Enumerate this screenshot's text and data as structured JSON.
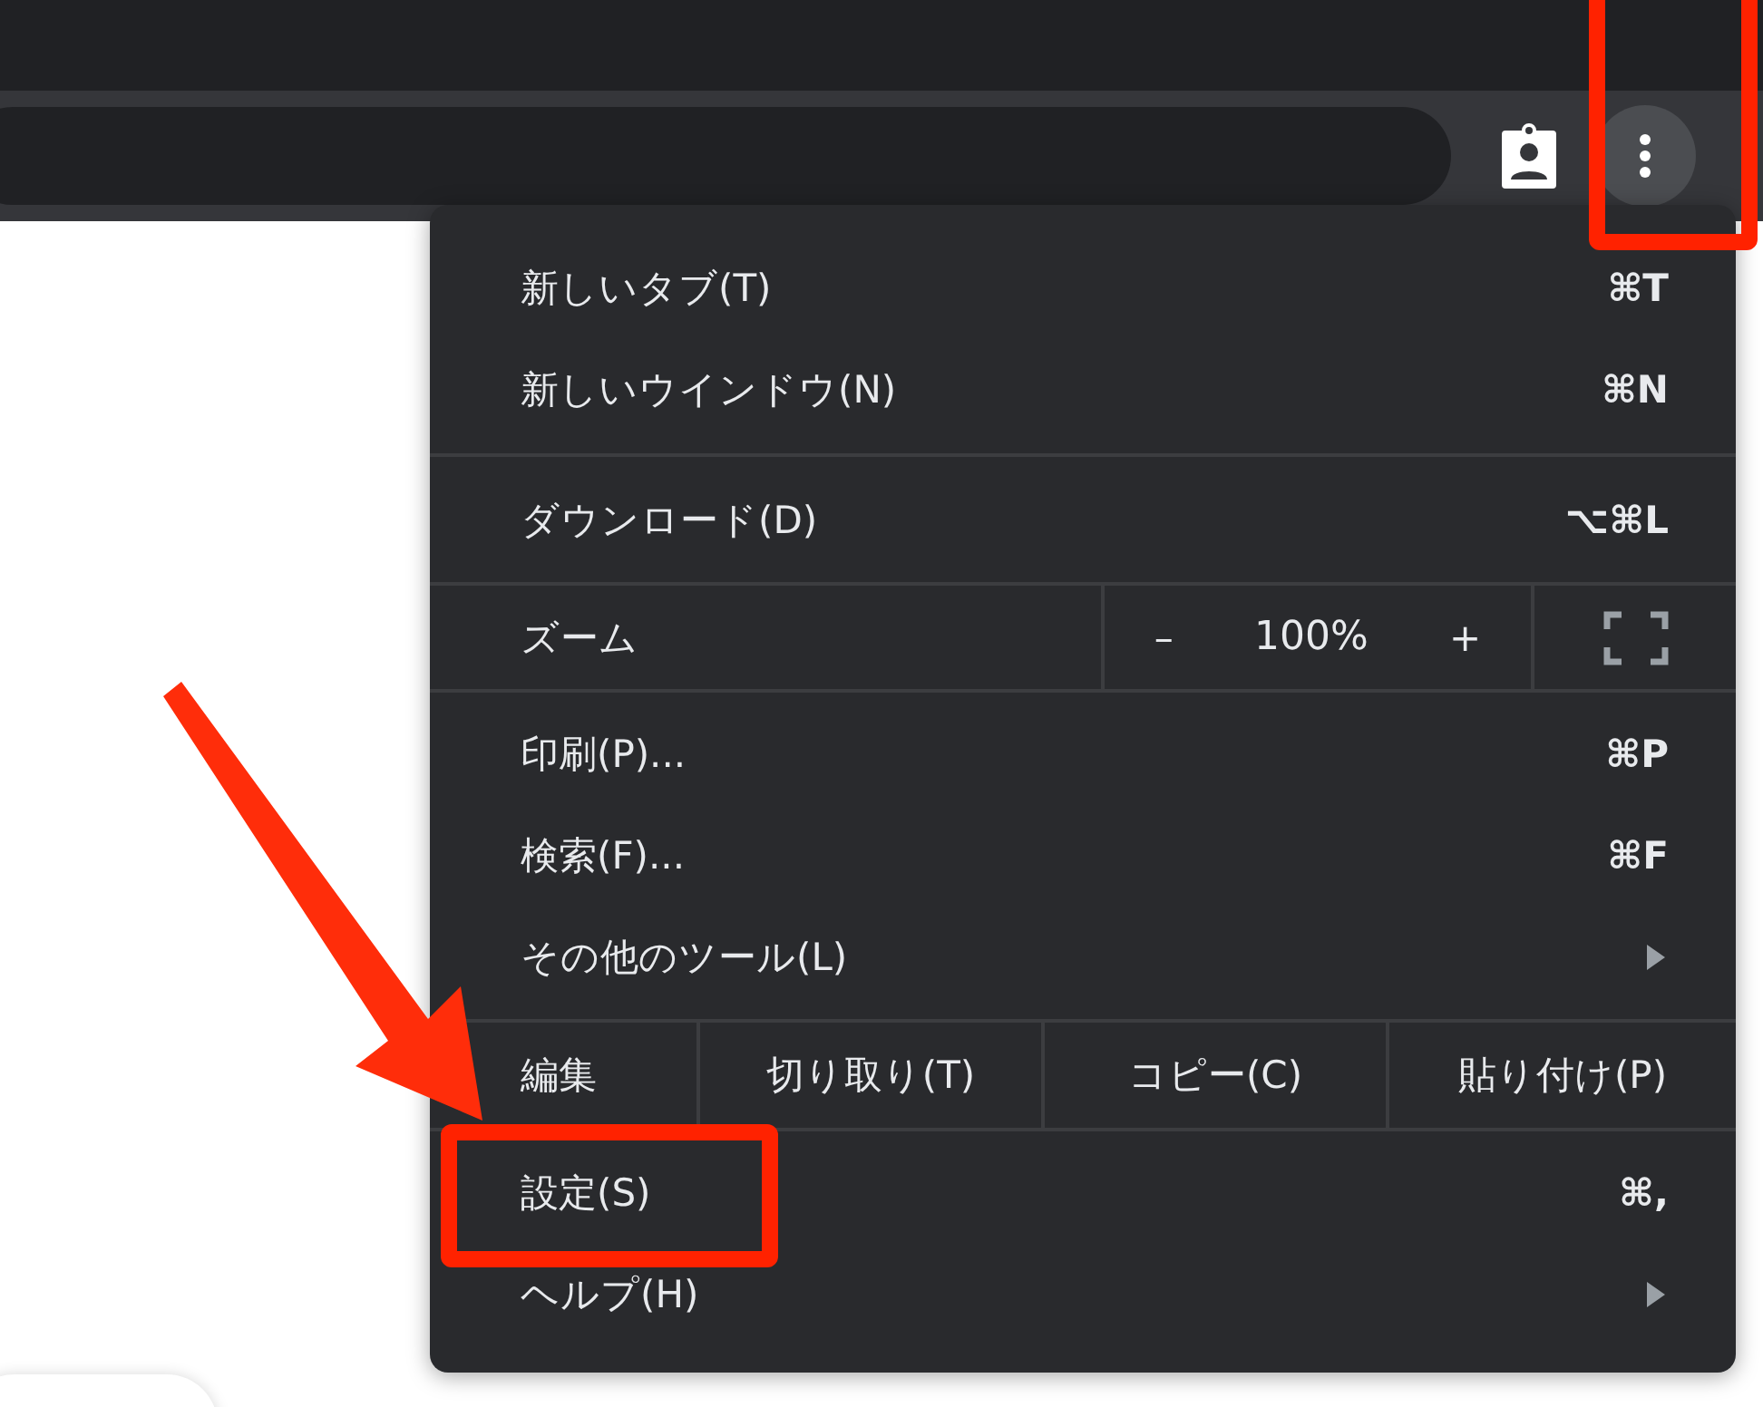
{
  "menu": {
    "items": [
      {
        "kind": "item",
        "label": "新しいタブ(T)",
        "shortcut": "⌘T",
        "submenu": false
      },
      {
        "kind": "item",
        "label": "新しいウインドウ(N)",
        "shortcut": "⌘N",
        "submenu": false
      },
      {
        "kind": "divider"
      },
      {
        "kind": "item",
        "label": "ダウンロード(D)",
        "shortcut": "⌥⌘L",
        "submenu": false
      },
      {
        "kind": "zoom",
        "label": "ズーム",
        "minus": "–",
        "value": "100%",
        "plus": "+"
      },
      {
        "kind": "item",
        "label": "印刷(P)...",
        "shortcut": "⌘P",
        "submenu": false
      },
      {
        "kind": "item",
        "label": "検索(F)...",
        "shortcut": "⌘F",
        "submenu": false
      },
      {
        "kind": "item",
        "label": "その他のツール(L)",
        "submenu": true
      },
      {
        "kind": "edit",
        "label": "編集",
        "actions": [
          "切り取り(T)",
          "コピー(C)",
          "貼り付け(P)"
        ]
      },
      {
        "kind": "item",
        "label": "設定(S)",
        "shortcut": "⌘,",
        "submenu": false
      },
      {
        "kind": "item",
        "label": "ヘルプ(H)",
        "submenu": true
      }
    ]
  }
}
